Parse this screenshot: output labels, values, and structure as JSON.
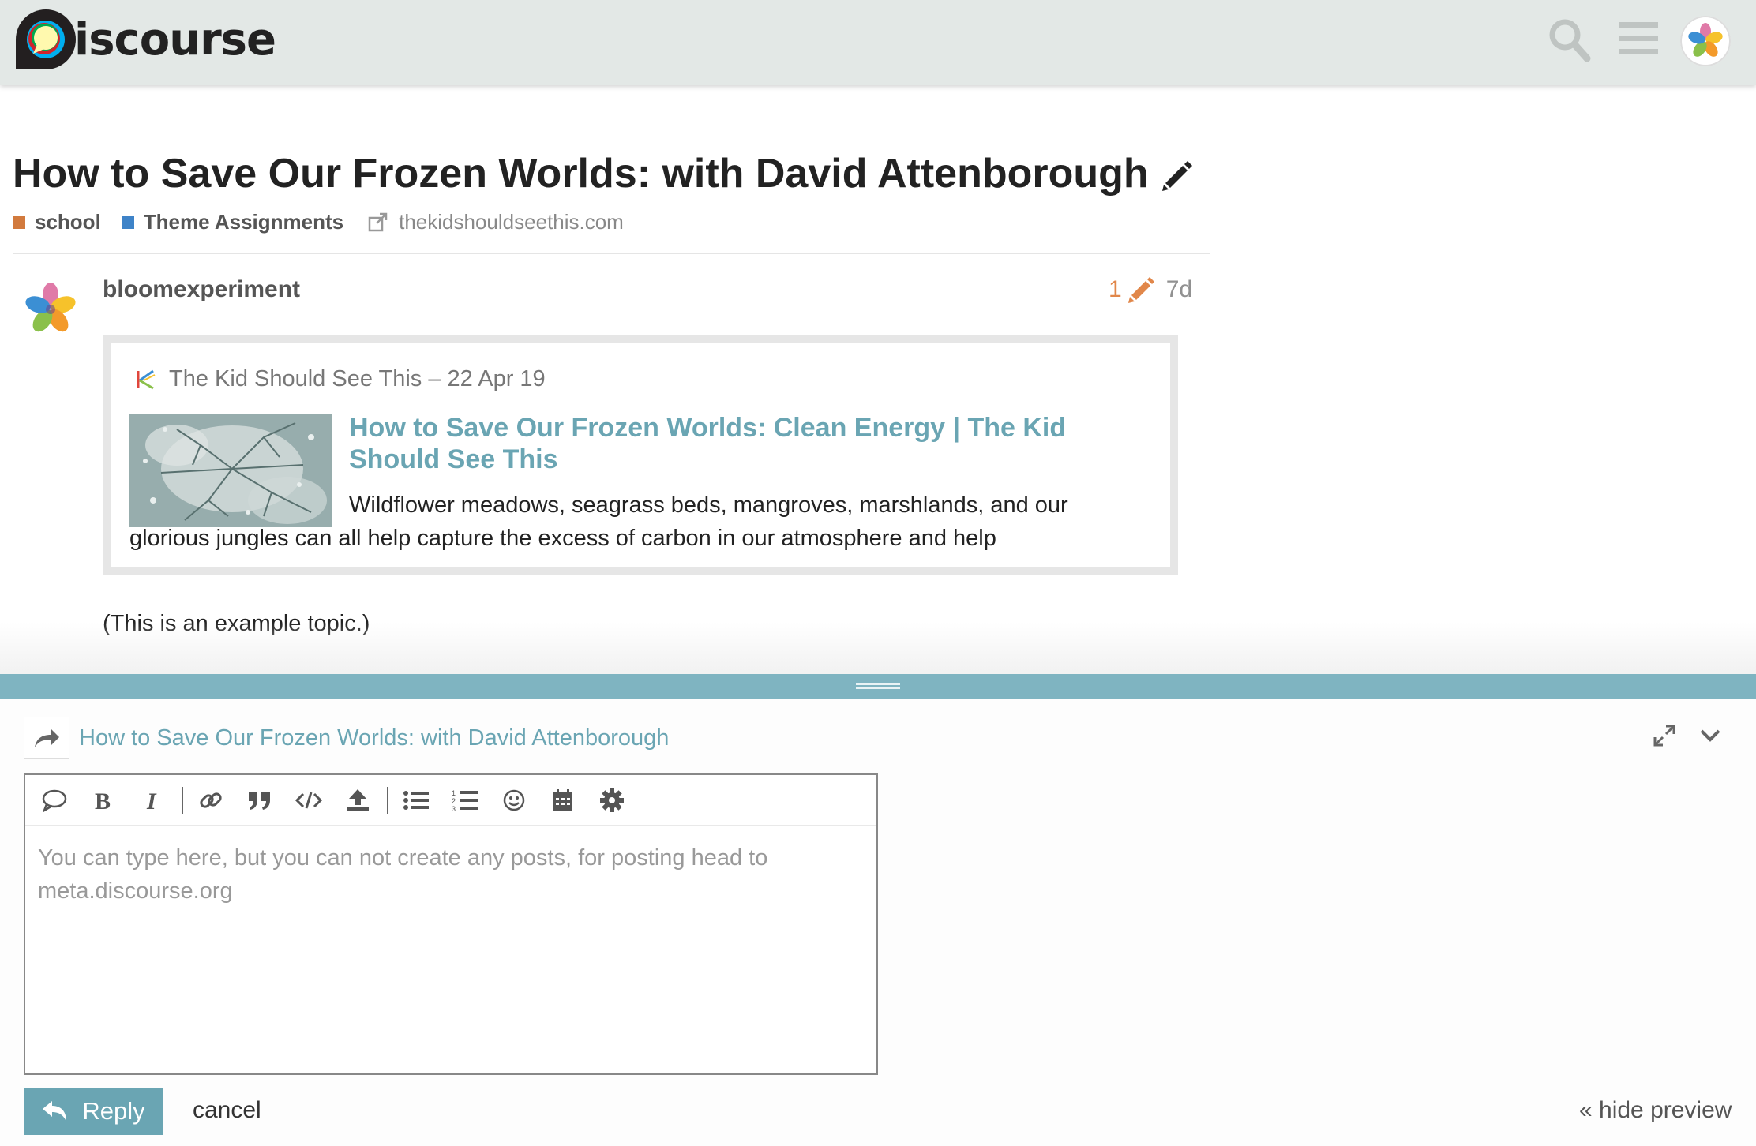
{
  "header": {
    "logo_text": "iscourse",
    "search_icon": "search-icon",
    "menu_icon": "hamburger-menu-icon",
    "avatar_icon": "avatar"
  },
  "topic": {
    "title": "How to Save Our Frozen Worlds: with David Attenborough",
    "categories": [
      {
        "name": "school",
        "color": "#d27a3d"
      },
      {
        "name": "Theme Assignments",
        "color": "#3e83c8"
      }
    ],
    "external_link": "thekidshouldseethis.com"
  },
  "post": {
    "username": "bloomexperiment",
    "edit_count": "1",
    "age": "7d",
    "onebox": {
      "source": "The Kid Should See This – 22 Apr 19",
      "title": "How to Save Our Frozen Worlds: Clean Energy | The Kid Should See This",
      "description_line1": "Wildflower meadows, seagrass beds, mangroves, marshlands, and our",
      "description_line2": "glorious jungles can all help capture the excess of carbon in our atmosphere and help"
    },
    "body": "(This is an example topic.)"
  },
  "composer": {
    "reply_to_title": "How to Save Our Frozen Worlds: with David Attenborough",
    "placeholder": "You can type here, but you can not create any posts, for posting head to meta.discourse.org",
    "reply_label": "Reply",
    "cancel_label": "cancel",
    "hide_preview_label": "« hide preview",
    "accent_color": "#6aa5b3"
  }
}
